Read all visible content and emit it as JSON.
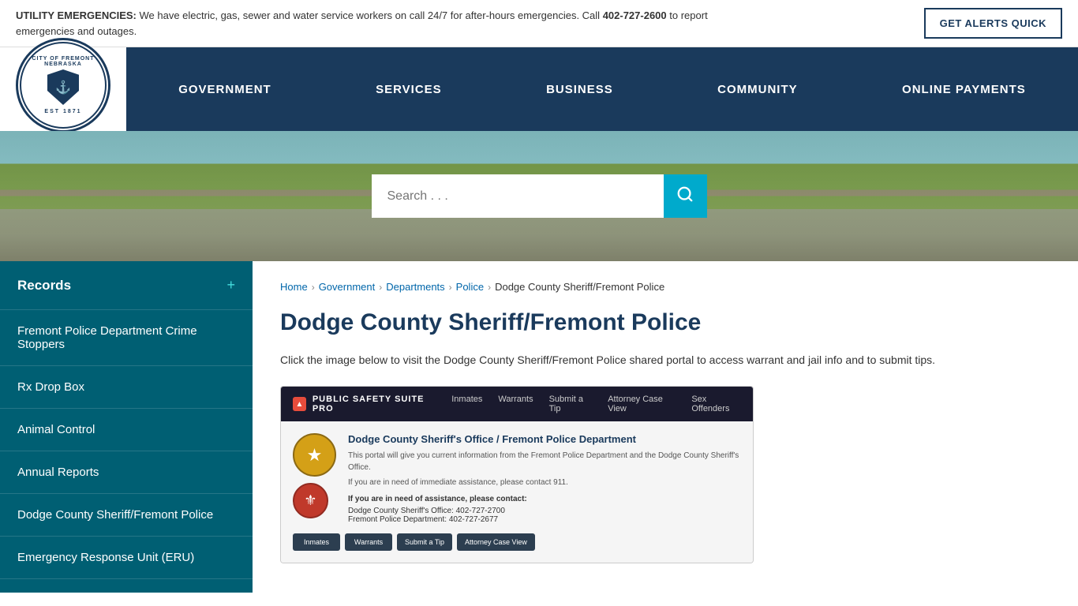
{
  "utility_bar": {
    "alert_text_bold": "UTILITY EMERGENCIES:",
    "alert_text": " We have electric, gas, sewer and water service workers on call 24/7 for after-hours emergencies. Call ",
    "phone": "402-727-2600",
    "alert_text2": " to report emergencies and outages.",
    "alerts_button": "GET ALERTS QUICK"
  },
  "header": {
    "logo_top": "CITY OF FREMONT NEBRASKA",
    "logo_bottom": "EST 1871",
    "nav_items": [
      {
        "label": "GOVERNMENT"
      },
      {
        "label": "SERVICES"
      },
      {
        "label": "BUSINESS"
      },
      {
        "label": "COMMUNITY"
      },
      {
        "label": "ONLINE PAYMENTS"
      }
    ]
  },
  "search": {
    "placeholder": "Search . . ."
  },
  "sidebar": {
    "main_item": "Records",
    "items": [
      {
        "label": "Fremont Police Department Crime Stoppers"
      },
      {
        "label": "Rx Drop Box"
      },
      {
        "label": "Animal Control"
      },
      {
        "label": "Annual Reports"
      },
      {
        "label": "Dodge County Sheriff/Fremont Police"
      },
      {
        "label": "Emergency Response Unit (ERU)"
      }
    ]
  },
  "breadcrumb": {
    "items": [
      {
        "label": "Home",
        "href": true
      },
      {
        "label": "Government",
        "href": true
      },
      {
        "label": "Departments",
        "href": true
      },
      {
        "label": "Police",
        "href": true
      },
      {
        "label": "Dodge County Sheriff/Fremont Police",
        "href": false
      }
    ]
  },
  "main": {
    "page_title": "Dodge County Sheriff/Fremont Police",
    "description": "Click the image below to visit the Dodge County Sheriff/Fremont Police shared portal to access warrant and jail info and to submit tips.",
    "portal": {
      "logo_text": "PUBLIC SAFETY SUITE PRO",
      "nav_items": [
        "Inmates",
        "Warrants",
        "Submit a Tip",
        "Attorney Case View",
        "Sex Offenders"
      ],
      "org_title": "Dodge County Sheriff's Office / Fremont Police Department",
      "info_text1": "This portal will give you current information from the Fremont Police Department and the Dodge County Sheriff's Office.",
      "info_text2": "If you are in need of immediate assistance, please contact 911.",
      "contact_title": "If you are in need of assistance, please contact:",
      "contact1": "Dodge County Sheriff's Office:  402-727-2700",
      "contact2": "Fremont Police Department:  402-727-2677",
      "buttons": [
        "Inmates",
        "Warrants",
        "Submit a Tip",
        "Attorney Case View"
      ]
    }
  }
}
